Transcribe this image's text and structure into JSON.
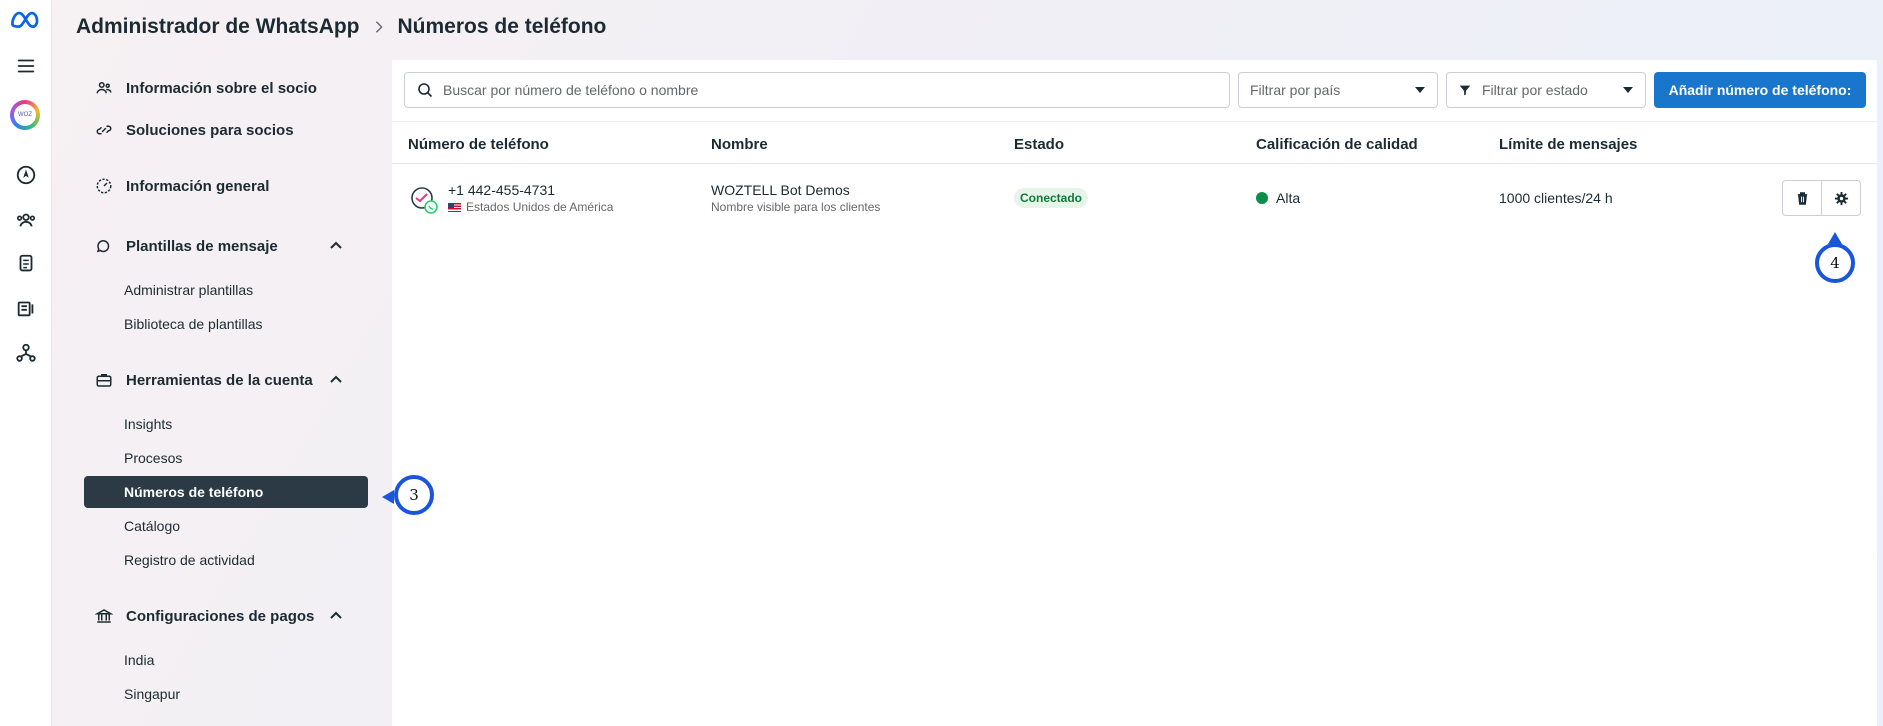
{
  "header": {
    "app_title": "Administrador de WhatsApp",
    "page_title": "Números de teléfono"
  },
  "rail": {
    "icons": [
      "meta-logo",
      "menu-icon",
      "business-avatar",
      "compass-icon",
      "people-icon",
      "documents-icon",
      "billing-icon",
      "network-icon"
    ]
  },
  "sidebar": {
    "items": [
      {
        "label": "Información sobre el socio",
        "icon": "partner-icon"
      },
      {
        "label": "Soluciones para socios",
        "icon": "link-icon"
      },
      {
        "label": "Información general",
        "icon": "gauge-icon"
      },
      {
        "label": "Plantillas de mensaje",
        "icon": "chat-icon",
        "expanded": true
      },
      {
        "label": "Herramientas de la cuenta",
        "icon": "briefcase-icon",
        "expanded": true
      },
      {
        "label": "Configuraciones de pagos",
        "icon": "bank-icon",
        "expanded": true
      }
    ],
    "templates_sub": [
      "Administrar plantillas",
      "Biblioteca de plantillas"
    ],
    "tools_sub": [
      "Insights",
      "Procesos",
      "Números de teléfono",
      "Catálogo",
      "Registro de actividad"
    ],
    "payments_sub": [
      "India",
      "Singapur"
    ],
    "active": "Números de teléfono"
  },
  "toolbar": {
    "search_placeholder": "Buscar por número de teléfono o nombre",
    "country_filter": "Filtrar por país",
    "status_filter": "Filtrar por estado",
    "add_button": "Añadir número de teléfono:"
  },
  "table": {
    "columns": [
      "Número de teléfono",
      "Nombre",
      "Estado",
      "Calificación de calidad",
      "Límite de mensajes"
    ],
    "rows": [
      {
        "phone": "+1 442-455-4731",
        "country": "Estados Unidos de América",
        "name": "WOZTELL Bot Demos",
        "name_sub": "Nombre visible para los clientes",
        "status": "Conectado",
        "quality": "Alta",
        "quality_color": "#0a8f4a",
        "limit": "1000 clientes/24 h"
      }
    ]
  },
  "markers": {
    "step3": "3",
    "step4": "4"
  },
  "colors": {
    "primary": "#1877cc",
    "active_nav": "#2b3a44",
    "marker": "#1a56db"
  }
}
